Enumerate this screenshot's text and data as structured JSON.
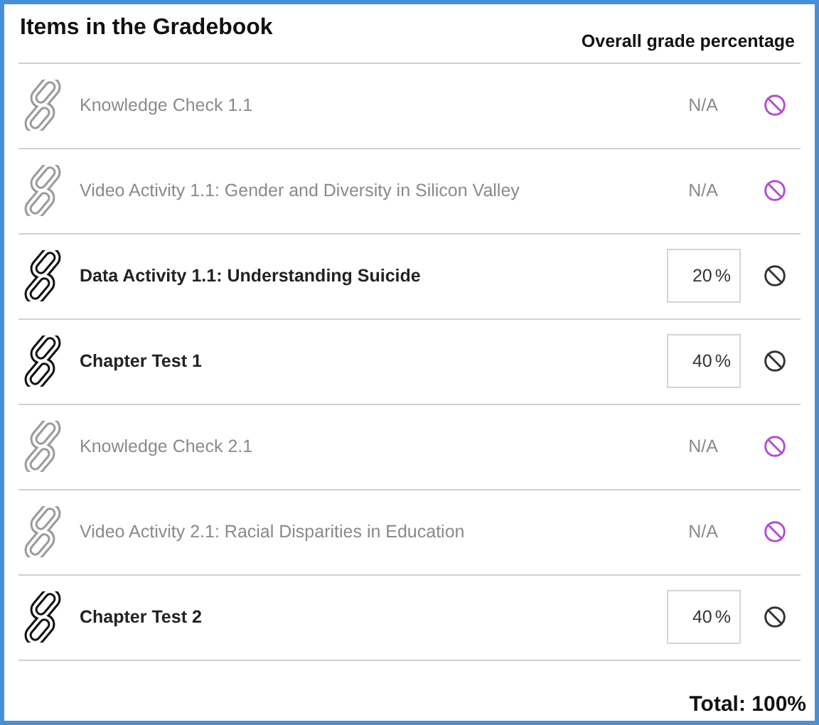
{
  "title": "Items in the Gradebook",
  "column_heading": "Overall grade percentage",
  "items": [
    {
      "name": "Knowledge Check 1.1",
      "included": false,
      "grade": "N/A"
    },
    {
      "name": "Video Activity 1.1: Gender and Diversity in Silicon Valley",
      "included": false,
      "grade": "N/A"
    },
    {
      "name": "Data Activity 1.1: Understanding Suicide",
      "included": true,
      "grade": "20",
      "unit": "%"
    },
    {
      "name": "Chapter Test 1",
      "included": true,
      "grade": "40",
      "unit": "%"
    },
    {
      "name": "Knowledge Check 2.1",
      "included": false,
      "grade": "N/A"
    },
    {
      "name": "Video Activity 2.1: Racial Disparities in Education",
      "included": false,
      "grade": "N/A"
    },
    {
      "name": "Chapter Test 2",
      "included": true,
      "grade": "40",
      "unit": "%"
    }
  ],
  "total": "Total: 100%"
}
